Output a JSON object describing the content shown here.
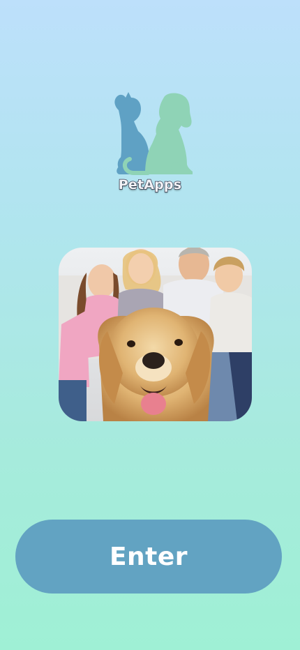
{
  "app": {
    "name": "PetApps"
  },
  "logo": {
    "icon": "cat-and-dog-silhouette-icon",
    "colors": {
      "cat": "#5fa1c4",
      "dog": "#8fd3b6"
    }
  },
  "hero_image": {
    "subject": "family-with-golden-retriever-photo"
  },
  "enter_button": {
    "label": "Enter",
    "color": "#62a3c2"
  }
}
